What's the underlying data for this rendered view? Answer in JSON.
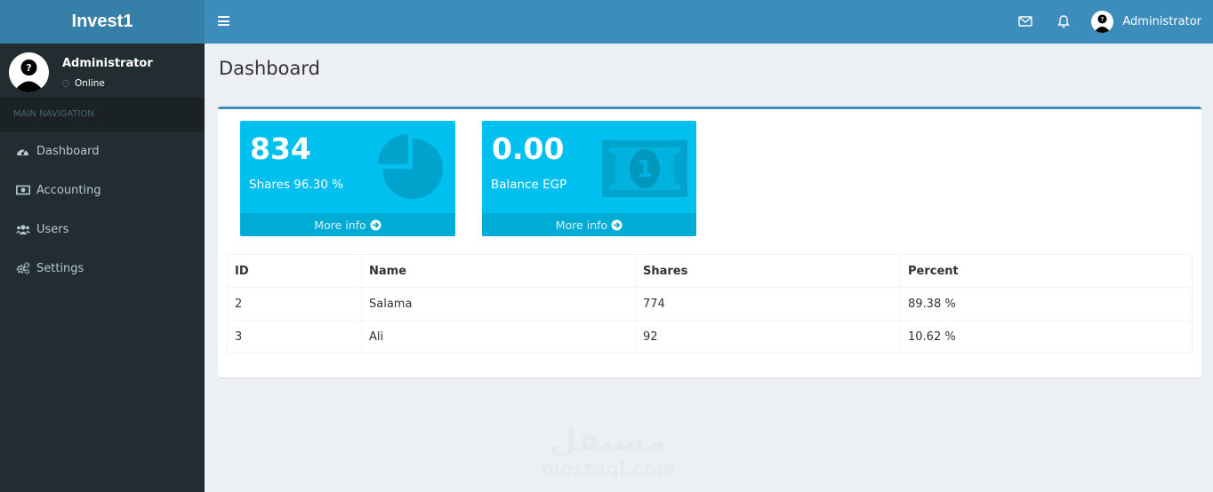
{
  "app": {
    "title": "Invest1"
  },
  "header": {
    "user_name": "Administrator"
  },
  "sidebar": {
    "user": {
      "name": "Administrator",
      "status": "Online"
    },
    "nav_header": "MAIN NAVIGATION",
    "items": [
      {
        "label": "Dashboard",
        "icon": "dashboard-icon"
      },
      {
        "label": "Accounting",
        "icon": "money-icon"
      },
      {
        "label": "Users",
        "icon": "users-icon"
      },
      {
        "label": "Settings",
        "icon": "gears-icon"
      }
    ]
  },
  "page": {
    "title": "Dashboard"
  },
  "cards": [
    {
      "value": "834",
      "label": "Shares 96.30 %",
      "footer": "More info",
      "icon": "pie-chart-icon"
    },
    {
      "value": "0.00",
      "label": "Balance EGP",
      "footer": "More info",
      "icon": "money-bill-icon"
    }
  ],
  "table": {
    "columns": [
      "ID",
      "Name",
      "Shares",
      "Percent"
    ],
    "rows": [
      [
        "2",
        "Salama",
        "774",
        "89.38 %"
      ],
      [
        "3",
        "Ali",
        "92",
        "10.62 %"
      ]
    ]
  },
  "watermark": {
    "arabic": "مستقل",
    "latin": "mostaql.com"
  },
  "colors": {
    "header": "#3c8dbc",
    "logo": "#367fa9",
    "sidebar": "#222d32",
    "card": "#00c0ef",
    "content_bg": "#ecf0f5"
  }
}
